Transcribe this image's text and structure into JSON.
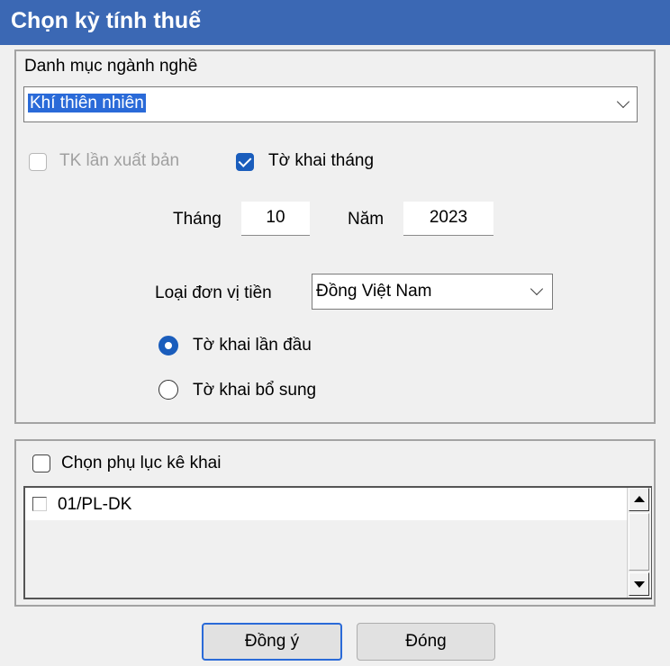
{
  "window": {
    "title": "Chọn kỳ tính thuế"
  },
  "industry": {
    "label": "Danh mục ngành nghề",
    "selected": "Khí thiên nhiên"
  },
  "options": {
    "reissue_label": "TK lần xuất bản",
    "reissue_checked": false,
    "reissue_enabled": false,
    "monthly_label": "Tờ khai tháng",
    "monthly_checked": true
  },
  "period": {
    "month_label": "Tháng",
    "month_value": "10",
    "year_label": "Năm",
    "year_value": "2023"
  },
  "currency": {
    "label": "Loại đơn vị tiền",
    "selected": "Đồng Việt Nam"
  },
  "declaration_type": {
    "options": [
      {
        "label": "Tờ khai lần đầu",
        "selected": true
      },
      {
        "label": "Tờ khai bổ sung",
        "selected": false
      }
    ]
  },
  "appendix": {
    "label": "Chọn phụ lục kê khai",
    "checked": false,
    "items": [
      {
        "label": "01/PL-DK",
        "checked": false
      }
    ]
  },
  "buttons": {
    "ok": "Đồng ý",
    "close": "Đóng"
  },
  "colors": {
    "titlebar": "#3b68b4",
    "accent": "#1a5dbc",
    "selection": "#2a6ad8"
  }
}
